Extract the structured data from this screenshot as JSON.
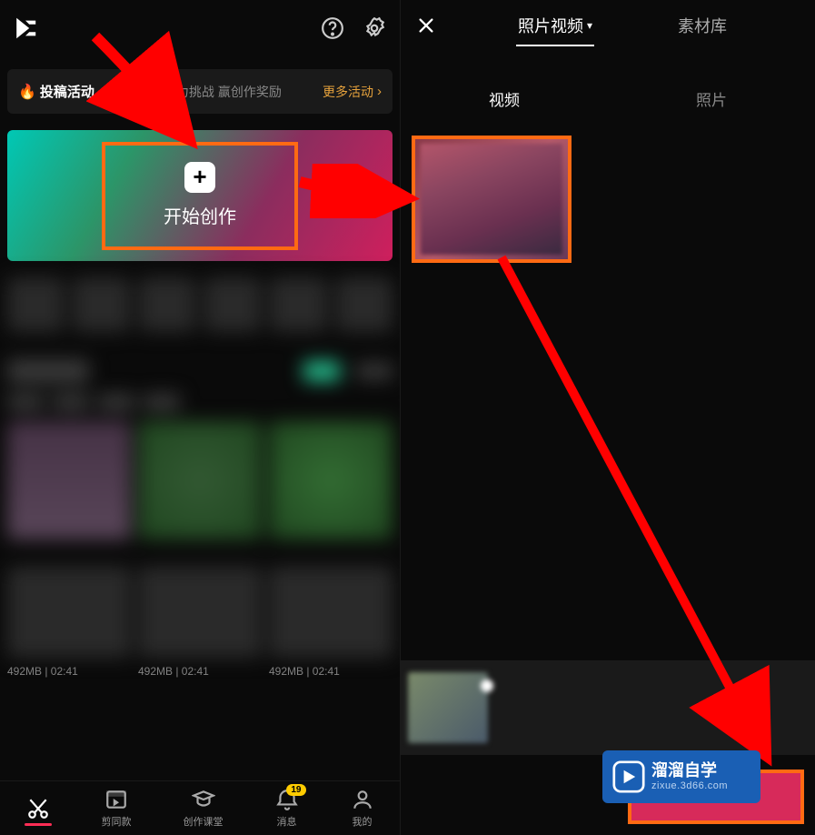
{
  "left": {
    "promo": {
      "badge": "投稿活动",
      "text": "参与剪映超能力挑战 赢创作奖励",
      "more": "更多活动"
    },
    "create_label": "开始创作",
    "meta": {
      "size_time": "492MB | 02:41"
    },
    "nav": {
      "edit": "剪同款",
      "course": "创作课堂",
      "msg": "消息",
      "msg_badge": "19",
      "mine": "我的"
    }
  },
  "right": {
    "tab_media": "照片视频",
    "tab_library": "素材库",
    "subtab_video": "视频",
    "subtab_photo": "照片"
  },
  "watermark": {
    "title": "溜溜自学",
    "sub": "zixue.3d66.com"
  }
}
